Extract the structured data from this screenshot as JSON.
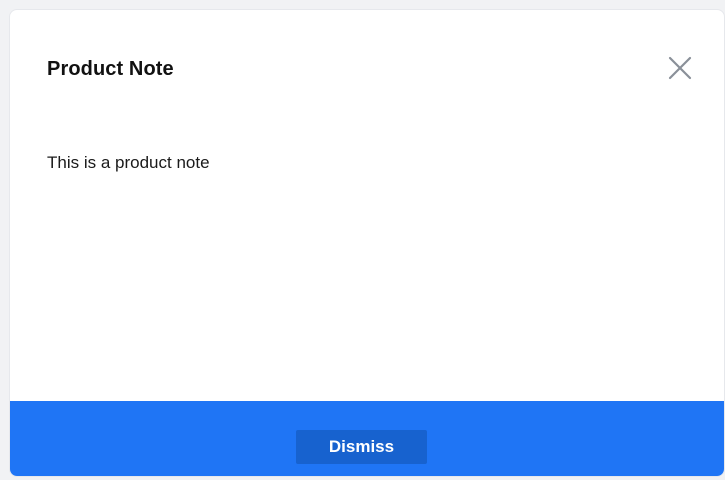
{
  "dialog": {
    "title": "Product Note",
    "message": "This is a product note",
    "close_icon": "close-icon",
    "dismiss_label": "Dismiss"
  },
  "colors": {
    "footer_background": "#1f75f5",
    "dismiss_button_background": "#1762cf",
    "close_icon": "#8a9099",
    "title_text": "#111111"
  }
}
